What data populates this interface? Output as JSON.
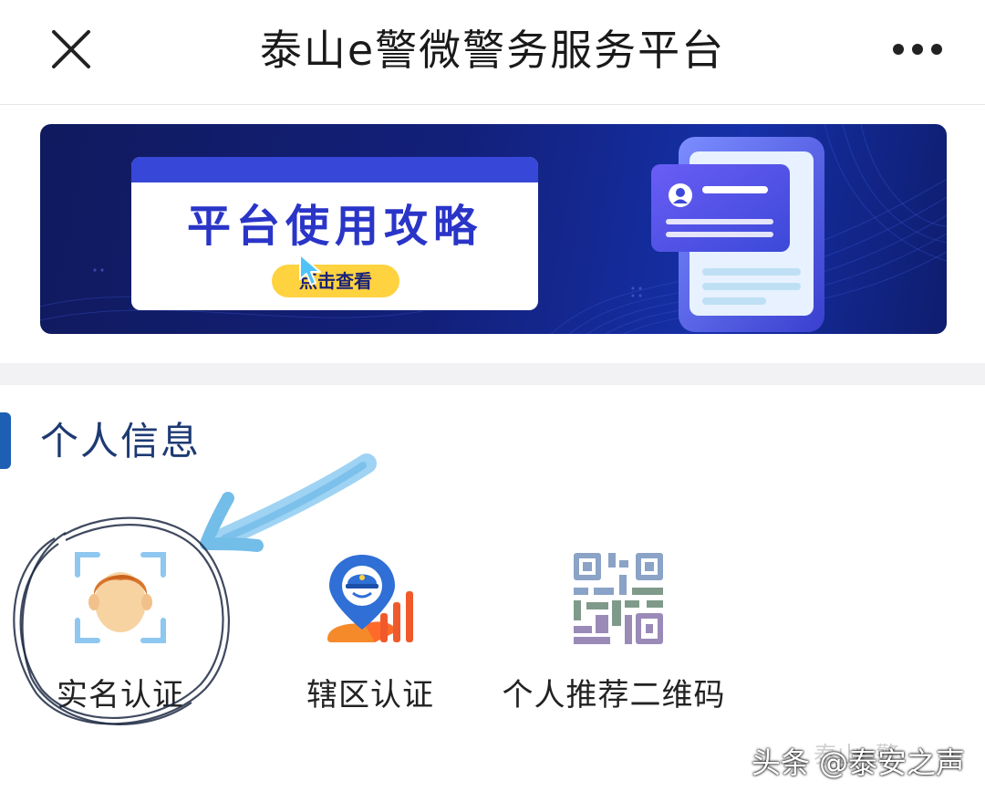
{
  "header": {
    "title": "泰山e警微警务服务平台",
    "close_icon": "close-icon",
    "more_icon": "more-dots-icon"
  },
  "banner": {
    "headline": "平台使用攻略",
    "cta": "点击查看",
    "accent_color": "#2a35c8",
    "cta_color": "#ffd23f"
  },
  "section": {
    "title": "个人信息",
    "bar_color": "#1d5fb2"
  },
  "items": [
    {
      "label": "实名认证",
      "icon": "face-id-icon"
    },
    {
      "label": "辖区认证",
      "icon": "police-location-icon"
    },
    {
      "label": "个人推荐二维码",
      "icon": "qr-code-icon"
    }
  ],
  "watermark": {
    "text": "头条 @泰安之声",
    "faint": "泰山e警"
  }
}
